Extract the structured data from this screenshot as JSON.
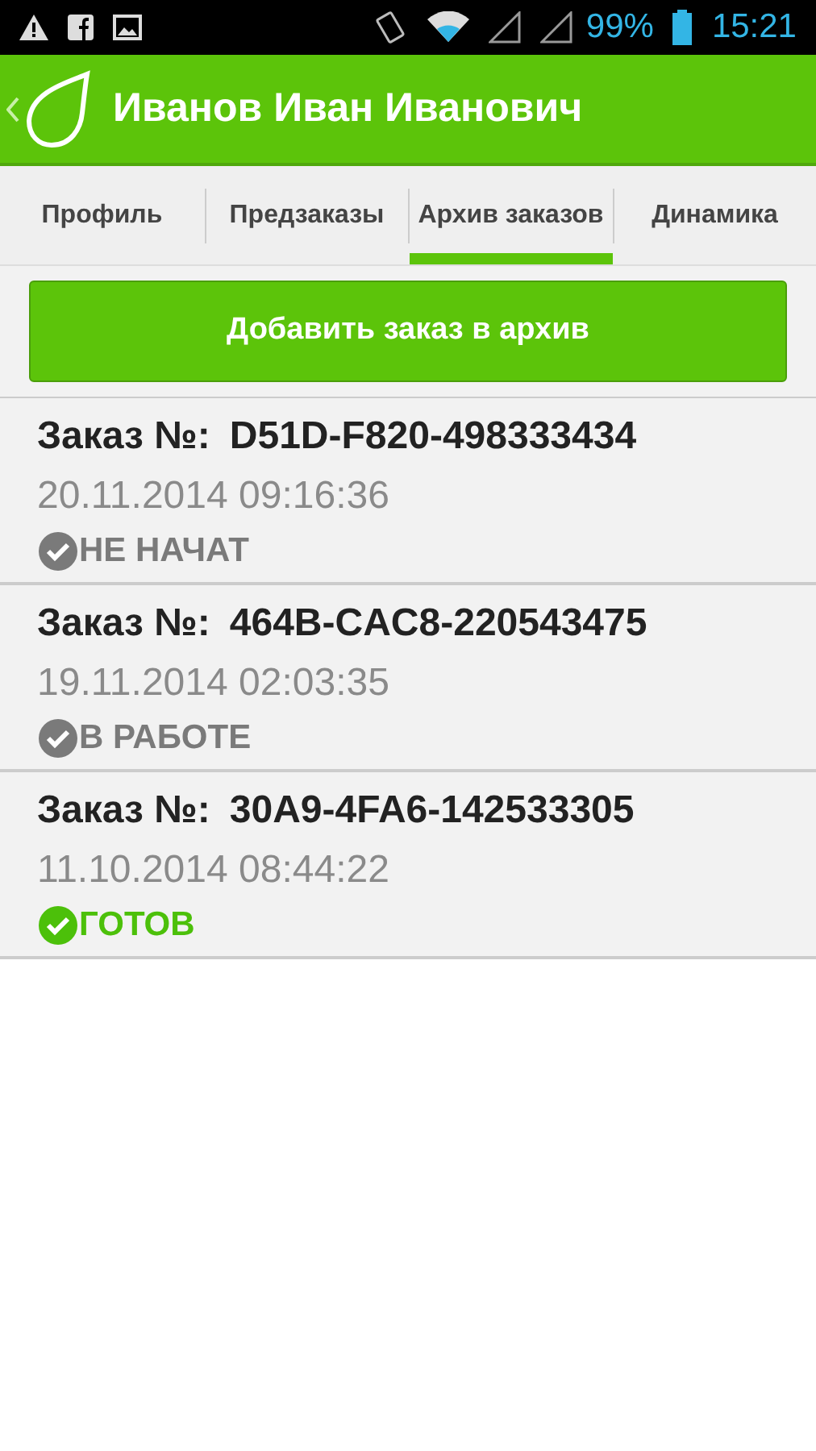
{
  "status_bar": {
    "battery": "99%",
    "time": "15:21"
  },
  "header": {
    "title": "Иванов Иван Иванович"
  },
  "tabs": [
    {
      "label": "Профиль",
      "selected": false
    },
    {
      "label": "Предзаказы",
      "selected": false
    },
    {
      "label": "Архив заказов",
      "selected": true
    },
    {
      "label": "Динамика",
      "selected": false
    }
  ],
  "add_button": "Добавить заказ в архив",
  "orders": [
    {
      "label": "Заказ №:",
      "number": "D51D-F820-498333434",
      "date": "20.11.2014 09:16:36",
      "status": "НЕ НАЧАТ",
      "color": "#7a7a7a"
    },
    {
      "label": "Заказ №:",
      "number": "464B-CAC8-220543475",
      "date": "19.11.2014 02:03:35",
      "status": "В РАБОТЕ",
      "color": "#7a7a7a"
    },
    {
      "label": "Заказ №:",
      "number": "30A9-4FA6-142533305",
      "date": "11.10.2014 08:44:22",
      "status": "ГОТОВ",
      "color": "#4cc00a"
    }
  ]
}
